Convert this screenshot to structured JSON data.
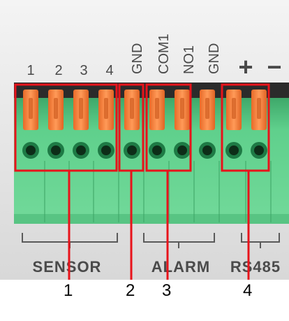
{
  "terminal_labels": {
    "t1": "1",
    "t2": "2",
    "t3": "3",
    "t4": "4",
    "gnd_a": "GND",
    "com1": "COM1",
    "no1": "NO1",
    "gnd_b": "GND",
    "plus": "+",
    "minus": "−"
  },
  "group_labels": {
    "sensor": "SENSOR",
    "alarm": "ALARM",
    "rs485": "RS485"
  },
  "callouts": [
    "1",
    "2",
    "3",
    "4"
  ],
  "colors": {
    "background_panel": "#e6e6e6",
    "terminal_body": "#5fd08c",
    "lever": "#f58a4a",
    "highlight_box": "#e8131b",
    "text": "#4a4a4a"
  }
}
